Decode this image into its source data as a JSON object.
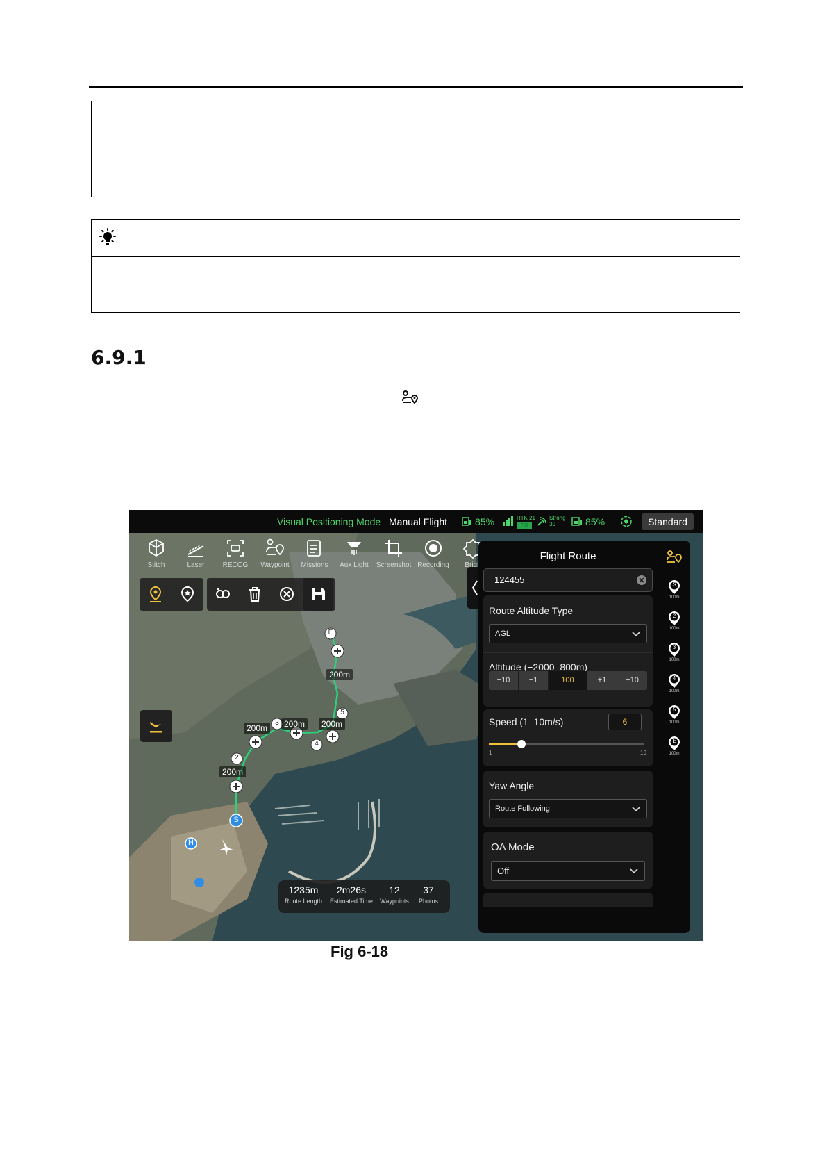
{
  "section": {
    "number": "6.9.1"
  },
  "figure": {
    "caption": "Fig 6-18"
  },
  "app": {
    "topbar": {
      "mode": "Visual Positioning Mode",
      "flight": "Manual Flight",
      "aircraft_battery": "85%",
      "rtk": "RTK 21",
      "rtk_fix": "FIX",
      "signal": "Strong",
      "signal_value": "30",
      "rc_battery": "85%",
      "standard_button": "Standard"
    },
    "toolbar": [
      {
        "label": "Stitch",
        "icon": "stitch-icon"
      },
      {
        "label": "Laser",
        "icon": "laser-icon"
      },
      {
        "label": "RECOG",
        "icon": "recog-icon"
      },
      {
        "label": "Waypoint",
        "icon": "waypoint-icon"
      },
      {
        "label": "Missions",
        "icon": "missions-icon"
      },
      {
        "label": "Aux Light",
        "icon": "aux-light-icon"
      },
      {
        "label": "Screenshot",
        "icon": "screenshot-icon"
      },
      {
        "label": "Recording",
        "icon": "recording-icon"
      },
      {
        "label": "Brigh",
        "icon": "brightness-icon"
      }
    ],
    "panel": {
      "title": "Flight Route",
      "route_name": "124455",
      "altitude_type_label": "Route Altitude Type",
      "altitude_type_value": "AGL",
      "altitude_label": "Altitude  (−2000–800m)",
      "altitude_steps": [
        "−10",
        "−1",
        "100",
        "+1",
        "+10"
      ],
      "speed_label": "Speed (1–10m/s)",
      "speed_value": "6",
      "speed_min": "1",
      "speed_max": "10",
      "speed_level": 6,
      "yaw_label": "Yaw Angle",
      "yaw_value": "Route Following",
      "oa_label": "OA Mode",
      "oa_value": "Off"
    },
    "waypoint_rail": [
      {
        "id": "S",
        "alt": "100m"
      },
      {
        "id": "2",
        "alt": "100m"
      },
      {
        "id": "3",
        "alt": "100m"
      },
      {
        "id": "4",
        "alt": "100m"
      },
      {
        "id": "5",
        "alt": "100m"
      },
      {
        "id": "E",
        "alt": "100m"
      }
    ],
    "map_labels": {
      "wp_e": "E",
      "wp_2": "2",
      "wp_3": "3",
      "wp_4": "4",
      "wp_5": "5",
      "wp_s": "S",
      "home": "H",
      "seg1": "200m",
      "seg2": "200m",
      "seg3": "200m",
      "seg4": "200m",
      "seg5": "200m"
    },
    "stats": [
      {
        "value": "1235m",
        "label": "Route Length"
      },
      {
        "value": "2m26s",
        "label": "Estimated Time"
      },
      {
        "value": "12",
        "label": "Waypoints"
      },
      {
        "value": "37",
        "label": "Photos"
      }
    ],
    "colors": {
      "accent": "#f0c23c",
      "status_green": "#4ed66a",
      "route_green": "#2bd27a",
      "start_blue": "#2f8de4"
    }
  }
}
